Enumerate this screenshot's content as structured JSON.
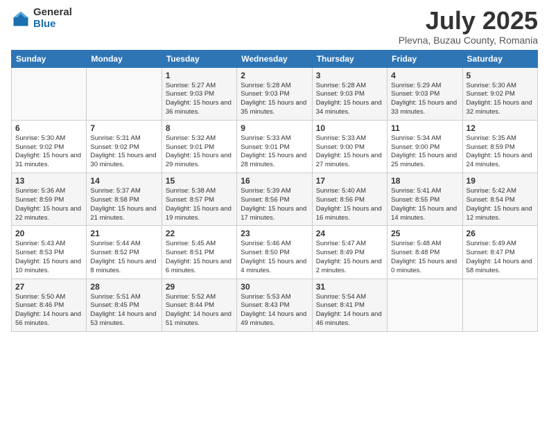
{
  "logo": {
    "general": "General",
    "blue": "Blue"
  },
  "title": "July 2025",
  "subtitle": "Plevna, Buzau County, Romania",
  "weekdays": [
    "Sunday",
    "Monday",
    "Tuesday",
    "Wednesday",
    "Thursday",
    "Friday",
    "Saturday"
  ],
  "weeks": [
    [
      {
        "day": "",
        "info": ""
      },
      {
        "day": "",
        "info": ""
      },
      {
        "day": "1",
        "info": "Sunrise: 5:27 AM\nSunset: 9:03 PM\nDaylight: 15 hours and 36 minutes."
      },
      {
        "day": "2",
        "info": "Sunrise: 5:28 AM\nSunset: 9:03 PM\nDaylight: 15 hours and 35 minutes."
      },
      {
        "day": "3",
        "info": "Sunrise: 5:28 AM\nSunset: 9:03 PM\nDaylight: 15 hours and 34 minutes."
      },
      {
        "day": "4",
        "info": "Sunrise: 5:29 AM\nSunset: 9:03 PM\nDaylight: 15 hours and 33 minutes."
      },
      {
        "day": "5",
        "info": "Sunrise: 5:30 AM\nSunset: 9:02 PM\nDaylight: 15 hours and 32 minutes."
      }
    ],
    [
      {
        "day": "6",
        "info": "Sunrise: 5:30 AM\nSunset: 9:02 PM\nDaylight: 15 hours and 31 minutes."
      },
      {
        "day": "7",
        "info": "Sunrise: 5:31 AM\nSunset: 9:02 PM\nDaylight: 15 hours and 30 minutes."
      },
      {
        "day": "8",
        "info": "Sunrise: 5:32 AM\nSunset: 9:01 PM\nDaylight: 15 hours and 29 minutes."
      },
      {
        "day": "9",
        "info": "Sunrise: 5:33 AM\nSunset: 9:01 PM\nDaylight: 15 hours and 28 minutes."
      },
      {
        "day": "10",
        "info": "Sunrise: 5:33 AM\nSunset: 9:00 PM\nDaylight: 15 hours and 27 minutes."
      },
      {
        "day": "11",
        "info": "Sunrise: 5:34 AM\nSunset: 9:00 PM\nDaylight: 15 hours and 25 minutes."
      },
      {
        "day": "12",
        "info": "Sunrise: 5:35 AM\nSunset: 8:59 PM\nDaylight: 15 hours and 24 minutes."
      }
    ],
    [
      {
        "day": "13",
        "info": "Sunrise: 5:36 AM\nSunset: 8:59 PM\nDaylight: 15 hours and 22 minutes."
      },
      {
        "day": "14",
        "info": "Sunrise: 5:37 AM\nSunset: 8:58 PM\nDaylight: 15 hours and 21 minutes."
      },
      {
        "day": "15",
        "info": "Sunrise: 5:38 AM\nSunset: 8:57 PM\nDaylight: 15 hours and 19 minutes."
      },
      {
        "day": "16",
        "info": "Sunrise: 5:39 AM\nSunset: 8:56 PM\nDaylight: 15 hours and 17 minutes."
      },
      {
        "day": "17",
        "info": "Sunrise: 5:40 AM\nSunset: 8:56 PM\nDaylight: 15 hours and 16 minutes."
      },
      {
        "day": "18",
        "info": "Sunrise: 5:41 AM\nSunset: 8:55 PM\nDaylight: 15 hours and 14 minutes."
      },
      {
        "day": "19",
        "info": "Sunrise: 5:42 AM\nSunset: 8:54 PM\nDaylight: 15 hours and 12 minutes."
      }
    ],
    [
      {
        "day": "20",
        "info": "Sunrise: 5:43 AM\nSunset: 8:53 PM\nDaylight: 15 hours and 10 minutes."
      },
      {
        "day": "21",
        "info": "Sunrise: 5:44 AM\nSunset: 8:52 PM\nDaylight: 15 hours and 8 minutes."
      },
      {
        "day": "22",
        "info": "Sunrise: 5:45 AM\nSunset: 8:51 PM\nDaylight: 15 hours and 6 minutes."
      },
      {
        "day": "23",
        "info": "Sunrise: 5:46 AM\nSunset: 8:50 PM\nDaylight: 15 hours and 4 minutes."
      },
      {
        "day": "24",
        "info": "Sunrise: 5:47 AM\nSunset: 8:49 PM\nDaylight: 15 hours and 2 minutes."
      },
      {
        "day": "25",
        "info": "Sunrise: 5:48 AM\nSunset: 8:48 PM\nDaylight: 15 hours and 0 minutes."
      },
      {
        "day": "26",
        "info": "Sunrise: 5:49 AM\nSunset: 8:47 PM\nDaylight: 14 hours and 58 minutes."
      }
    ],
    [
      {
        "day": "27",
        "info": "Sunrise: 5:50 AM\nSunset: 8:46 PM\nDaylight: 14 hours and 56 minutes."
      },
      {
        "day": "28",
        "info": "Sunrise: 5:51 AM\nSunset: 8:45 PM\nDaylight: 14 hours and 53 minutes."
      },
      {
        "day": "29",
        "info": "Sunrise: 5:52 AM\nSunset: 8:44 PM\nDaylight: 14 hours and 51 minutes."
      },
      {
        "day": "30",
        "info": "Sunrise: 5:53 AM\nSunset: 8:43 PM\nDaylight: 14 hours and 49 minutes."
      },
      {
        "day": "31",
        "info": "Sunrise: 5:54 AM\nSunset: 8:41 PM\nDaylight: 14 hours and 46 minutes."
      },
      {
        "day": "",
        "info": ""
      },
      {
        "day": "",
        "info": ""
      }
    ]
  ]
}
